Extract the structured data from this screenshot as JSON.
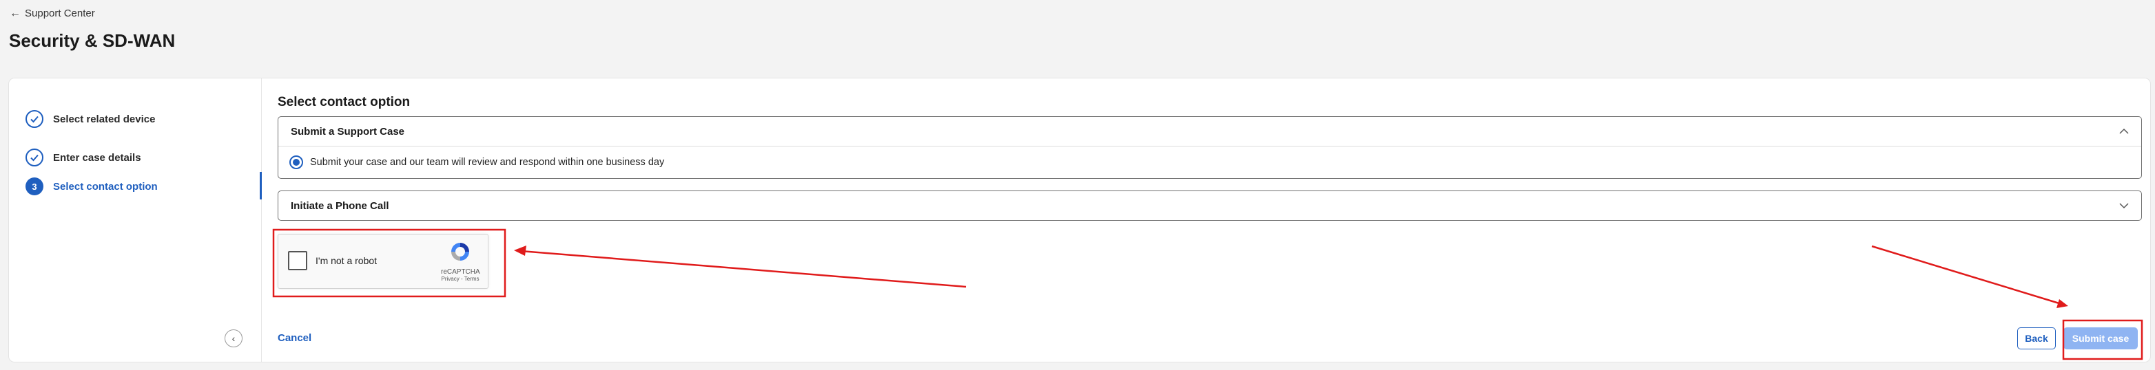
{
  "header": {
    "back_label": "Support Center",
    "title": "Security & SD-WAN"
  },
  "sidebar": {
    "steps": [
      {
        "label": "Select related device",
        "state": "done"
      },
      {
        "label": "Enter case details",
        "state": "done"
      },
      {
        "label": "Select contact option",
        "number": "3",
        "state": "active"
      }
    ]
  },
  "main": {
    "section_title": "Select contact option",
    "options": [
      {
        "title": "Submit a Support Case",
        "expanded": true,
        "description": "Submit your case and our team will review and respond within one business day"
      },
      {
        "title": "Initiate a Phone Call",
        "expanded": false
      }
    ],
    "captcha": {
      "label": "I'm not a robot",
      "brand": "reCAPTCHA",
      "terms": "Privacy - Terms"
    },
    "cancel_label": "Cancel",
    "back_label": "Back",
    "submit_label": "Submit case"
  },
  "colors": {
    "accent": "#1f5fbf",
    "submit_disabled": "#8fb4f2",
    "annotation": "#e01b1b"
  }
}
